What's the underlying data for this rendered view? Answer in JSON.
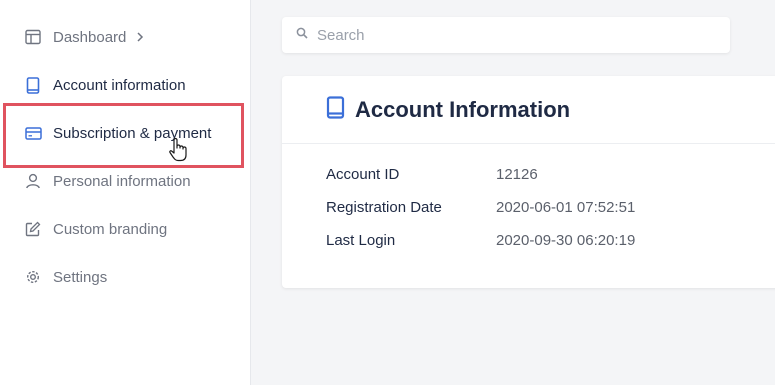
{
  "sidebar": {
    "items": [
      {
        "label": "Dashboard",
        "icon": "layout-icon"
      },
      {
        "label": "Account information",
        "icon": "book-icon"
      },
      {
        "label": "Subscription & payment",
        "icon": "credit-card-icon"
      },
      {
        "label": "Personal information",
        "icon": "user-icon"
      },
      {
        "label": "Custom branding",
        "icon": "edit-icon"
      },
      {
        "label": "Settings",
        "icon": "gear-icon"
      }
    ]
  },
  "search": {
    "placeholder": "Search"
  },
  "card": {
    "title": "Account Information",
    "rows": [
      {
        "label": "Account ID",
        "value": "12126"
      },
      {
        "label": "Registration Date",
        "value": "2020-06-01 07:52:51"
      },
      {
        "label": "Last Login",
        "value": "2020-09-30 06:20:19"
      }
    ]
  },
  "colors": {
    "accent": "#3b6fd8",
    "highlight": "#e0535f",
    "text_dark": "#1f2a44",
    "text_gray": "#6f7480"
  }
}
